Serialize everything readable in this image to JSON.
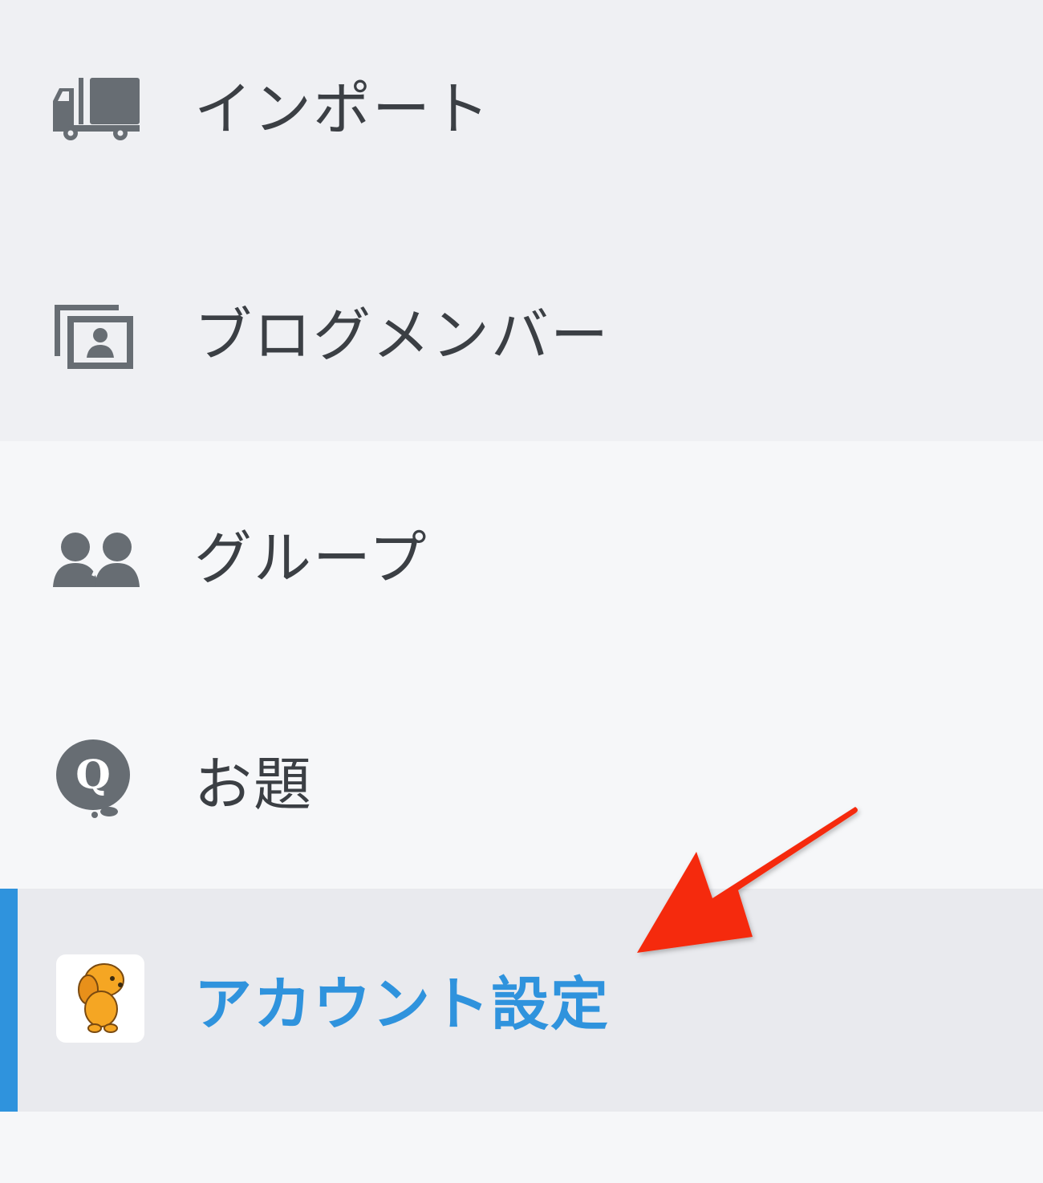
{
  "menu": {
    "items": [
      {
        "label": "インポート",
        "icon": "truck-icon"
      },
      {
        "label": "ブログメンバー",
        "icon": "member-card-icon"
      },
      {
        "label": "グループ",
        "icon": "group-users-icon"
      },
      {
        "label": "お題",
        "icon": "question-bubble-icon"
      },
      {
        "label": "アカウント設定",
        "icon": "user-avatar",
        "active": true
      }
    ]
  },
  "annotation": {
    "arrow": "red-arrow"
  },
  "colors": {
    "accent": "#2f93dd",
    "icon": "#676d73",
    "text": "#3b3f44",
    "top_group_bg": "#eff0f3",
    "bottom_group_bg": "#f6f7f9",
    "active_bg": "#e9eaee",
    "arrow": "#f52a0e"
  }
}
